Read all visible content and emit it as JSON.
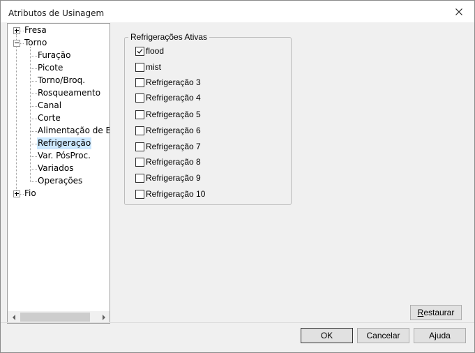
{
  "window": {
    "title": "Atributos de Usinagem"
  },
  "tree": {
    "items": [
      {
        "label": "Fresa",
        "level": 0,
        "expander": "plus"
      },
      {
        "label": "Torno",
        "level": 0,
        "expander": "minus"
      },
      {
        "label": "Furação",
        "level": 1
      },
      {
        "label": "Picote",
        "level": 1
      },
      {
        "label": "Torno/Broq.",
        "level": 1
      },
      {
        "label": "Rosqueamento",
        "level": 1
      },
      {
        "label": "Canal",
        "level": 1
      },
      {
        "label": "Corte",
        "level": 1
      },
      {
        "label": "Alimentação de Bar",
        "level": 1
      },
      {
        "label": "Refrigeração",
        "level": 1,
        "selected": true
      },
      {
        "label": "Var. PósProc.",
        "level": 1
      },
      {
        "label": "Variados",
        "level": 1
      },
      {
        "label": "Operações",
        "level": 1
      },
      {
        "label": "Fio",
        "level": 0,
        "expander": "plus"
      }
    ]
  },
  "group": {
    "legend": "Refrigerações Ativas",
    "options": [
      {
        "label": "flood",
        "checked": true
      },
      {
        "label": "mist",
        "checked": false
      },
      {
        "label": "Refrigeração 3",
        "checked": false
      },
      {
        "label": "Refrigeração 4",
        "checked": false
      },
      {
        "label": "Refrigeração 5",
        "checked": false
      },
      {
        "label": "Refrigeração 6",
        "checked": false
      },
      {
        "label": "Refrigeração 7",
        "checked": false
      },
      {
        "label": "Refrigeração 8",
        "checked": false
      },
      {
        "label": "Refrigeração 9",
        "checked": false
      },
      {
        "label": "Refrigeração 10",
        "checked": false
      }
    ]
  },
  "buttons": {
    "restore": "Restaurar",
    "ok": "OK",
    "cancel": "Cancelar",
    "help": "Ajuda"
  },
  "icons": {
    "close": "close-icon",
    "expand": "plus-box-icon",
    "collapse": "minus-box-icon",
    "check": "checkmark-icon",
    "scroll_left": "arrow-left-icon",
    "scroll_right": "arrow-right-icon"
  },
  "colors": {
    "selection": "#cce8ff",
    "dialog_bg": "#f0f0f0"
  }
}
